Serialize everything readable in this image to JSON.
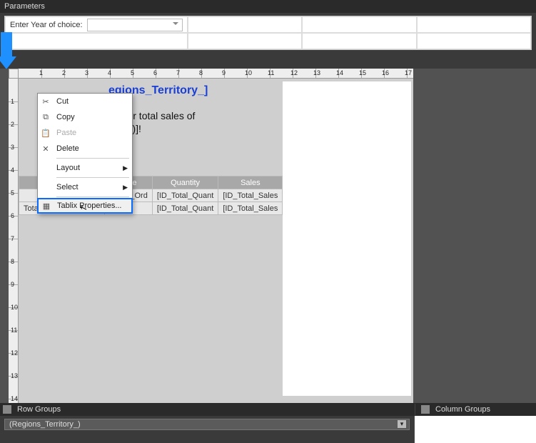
{
  "header": {
    "title": "Parameters"
  },
  "params": {
    "label": "Enter Year of choice:",
    "value": ""
  },
  "ruler": {
    "h": [
      1,
      2,
      3,
      4,
      5,
      6,
      7,
      8,
      9,
      10,
      11,
      12,
      13,
      14,
      15,
      16,
      17
    ],
    "v": [
      1,
      2,
      3,
      4,
      5,
      6,
      7,
      8,
      9,
      10,
      11,
      12,
      13,
      14
    ]
  },
  "report": {
    "title": "egions_Territory_]",
    "line1": "n your total sales of",
    "line2": "ales_)]!",
    "tablix": {
      "headers": [
        "",
        "Date",
        "Quantity",
        "Sales"
      ],
      "rows": [
        [
          "",
          "_Data_Ord",
          "[ID_Total_Quant",
          "[ID_Total_Sales"
        ],
        [
          "Total",
          "",
          "[ID_Total_Quant",
          "[ID_Total_Sales"
        ]
      ]
    }
  },
  "context_menu": {
    "cut": "Cut",
    "copy": "Copy",
    "paste": "Paste",
    "delete": "Delete",
    "layout": "Layout",
    "select": "Select",
    "tablix": "Tablix Properties..."
  },
  "groups": {
    "row_label": "Row Groups",
    "col_label": "Column Groups",
    "row_group_name": "(Regions_Territory_)"
  }
}
